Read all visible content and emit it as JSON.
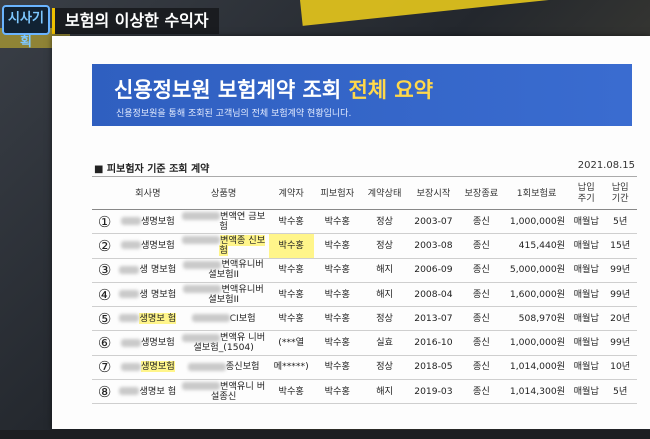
{
  "overlay": {
    "logo_text": "시사기획",
    "headline": "보험의 이상한 수익자"
  },
  "document": {
    "banner_title_prefix": "신용정보원 보험계약 조회 ",
    "banner_title_highlight": "전체 요약",
    "banner_subtitle": "신용정보원을 통해 조회된 고객님의 전체 보험계약 현황입니다.",
    "section_label": "■ 피보험자 기준 조회 계약",
    "date": "2021.08.15",
    "headers": [
      "회사명",
      "상품명",
      "계약자",
      "피보험자",
      "계약상태",
      "보장시작",
      "보장종료",
      "1회보험료",
      "납입\n주기",
      "납입\n기간"
    ],
    "rows": [
      {
        "no": "①",
        "company": "생명보험",
        "product": "변액연 금보험",
        "contractor": "박수홍",
        "insured": "박수홍",
        "status": "정상",
        "start": "2003-07",
        "end": "종신",
        "premium": "1,000,000원",
        "cycle": "매월납",
        "period": "5년"
      },
      {
        "no": "②",
        "company": "생명보험",
        "product": "변액종 신보험",
        "contractor": "박수홍",
        "insured": "박수홍",
        "status": "정상",
        "start": "2003-08",
        "end": "종신",
        "premium": "415,440원",
        "cycle": "매월납",
        "period": "15년"
      },
      {
        "no": "③",
        "company": "생 명보험",
        "product": "변액유니버셜보험II",
        "contractor": "박수홍",
        "insured": "박수홍",
        "status": "해지",
        "start": "2006-09",
        "end": "종신",
        "premium": "5,000,000원",
        "cycle": "매월납",
        "period": "99년"
      },
      {
        "no": "④",
        "company": "생 명보험",
        "product": "변액유니버셜보험II",
        "contractor": "박수홍",
        "insured": "박수홍",
        "status": "해지",
        "start": "2008-04",
        "end": "종신",
        "premium": "1,600,000원",
        "cycle": "매월납",
        "period": "99년"
      },
      {
        "no": "⑤",
        "company": "생명보 험",
        "product": "CI보험",
        "contractor": "박수홍",
        "insured": "박수홍",
        "status": "정상",
        "start": "2013-07",
        "end": "종신",
        "premium": "508,970원",
        "cycle": "매월납",
        "period": "20년"
      },
      {
        "no": "⑥",
        "company": "생명보험",
        "product": "변액유 니버셜보험_(1504)",
        "contractor": "(***열",
        "insured": "박수홍",
        "status": "실효",
        "start": "2016-10",
        "end": "종신",
        "premium": "1,000,000원",
        "cycle": "매월납",
        "period": "99년"
      },
      {
        "no": "⑦",
        "company": "생명보험",
        "product": "종신보험",
        "contractor": "메*****)",
        "insured": "박수홍",
        "status": "정상",
        "start": "2018-05",
        "end": "종신",
        "premium": "1,014,000원",
        "cycle": "매월납",
        "period": "10년"
      },
      {
        "no": "⑧",
        "company": "생명보 험",
        "product": "변액유니 버설종신",
        "contractor": "박수홍",
        "insured": "박수홍",
        "status": "해지",
        "start": "2019-03",
        "end": "종신",
        "premium": "1,014,300원",
        "cycle": "매월납",
        "period": "5년"
      }
    ]
  }
}
